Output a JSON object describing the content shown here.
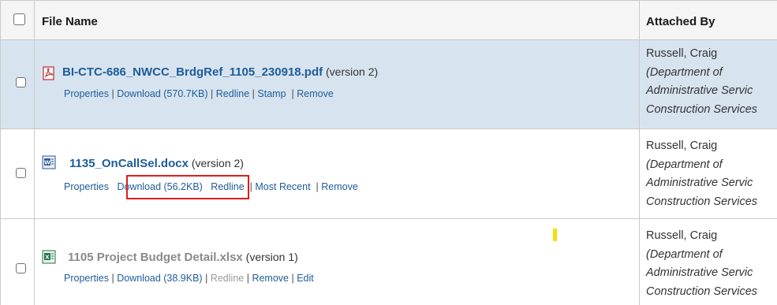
{
  "header": {
    "col_file_name": "File Name",
    "col_attached_by": "Attached By"
  },
  "rows": [
    {
      "file_name": "BI-CTC-686_NWCC_BrdgRef_1105_230918.pdf",
      "version": "(version 2)",
      "icon": "pdf-file-icon",
      "links": {
        "properties": "Properties",
        "download": "Download (570.7KB)",
        "redline": "Redline",
        "stamp": "Stamp",
        "remove": "Remove"
      },
      "attached_by": {
        "name": "Russell, Craig",
        "dept1": "(Department of",
        "dept2": "Administrative Servic",
        "dept3": "Construction Services"
      }
    },
    {
      "file_name": "1135_OnCallSel.docx",
      "version": "(version 2)",
      "icon": "word-file-icon",
      "links": {
        "properties": "Properties",
        "download": "Download (56.2KB)",
        "redline": "Redline",
        "most_recent": "Most Recent",
        "remove": "Remove"
      },
      "attached_by": {
        "name": "Russell, Craig",
        "dept1": "(Department of",
        "dept2": "Administrative Servic",
        "dept3": "Construction Services"
      }
    },
    {
      "file_name": "1105 Project Budget Detail.xlsx",
      "version": "(version 1)",
      "icon": "excel-file-icon",
      "links": {
        "properties": "Properties",
        "download": "Download (38.9KB)",
        "redline": "Redline",
        "remove": "Remove",
        "edit": "Edit"
      },
      "attached_by": {
        "name": "Russell, Craig",
        "dept1": "(Department of",
        "dept2": "Administrative Servic",
        "dept3": "Construction Services"
      }
    }
  ],
  "colors": {
    "link": "#1f5c99",
    "selected_row": "#d7e4f0",
    "highlight": "#e01b1b"
  }
}
